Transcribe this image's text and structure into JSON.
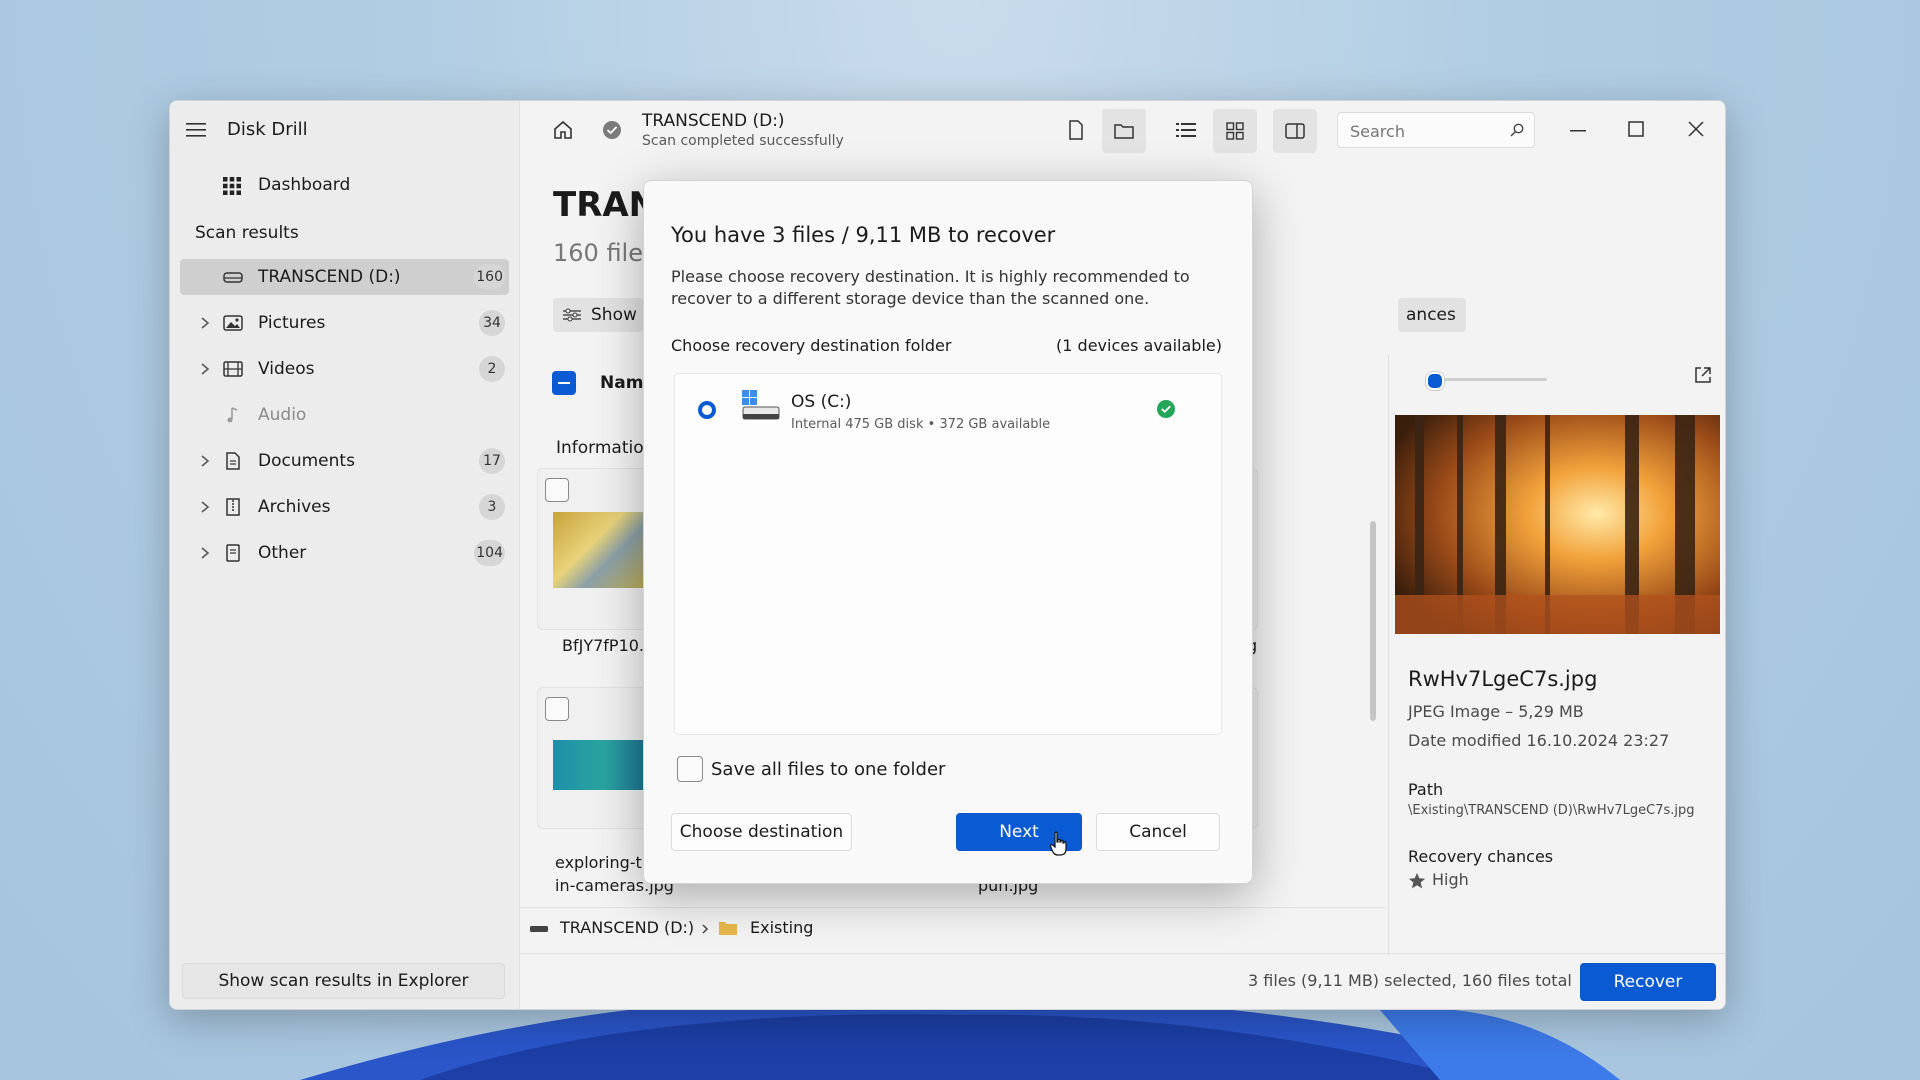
{
  "app": {
    "title": "Disk Drill"
  },
  "sidebar": {
    "dashboard_label": "Dashboard",
    "section_label": "Scan results",
    "items": [
      {
        "label": "TRANSCEND (D:)",
        "count": "160"
      },
      {
        "label": "Pictures",
        "count": "34"
      },
      {
        "label": "Videos",
        "count": "2"
      },
      {
        "label": "Audio",
        "count": ""
      },
      {
        "label": "Documents",
        "count": "17"
      },
      {
        "label": "Archives",
        "count": "3"
      },
      {
        "label": "Other",
        "count": "104"
      }
    ],
    "explorer_button": "Show scan results in Explorer"
  },
  "header": {
    "device": "TRANSCEND (D:)",
    "status": "Scan completed successfully",
    "search_placeholder": "Search"
  },
  "main": {
    "title_partial": "TRAN",
    "subtitle_partial": "160 files",
    "show_button": "Show",
    "chances_partial": "ances",
    "name_column": "Name",
    "info_partial": "Information",
    "files": [
      {
        "name": "BfJY7fP10."
      },
      {
        "name_line1": "exploring-t",
        "name_line2": "in-cameras.jpg"
      },
      {
        "name": "g"
      },
      {
        "name": "pun.jpg"
      }
    ],
    "breadcrumb": {
      "drive": "TRANSCEND (D:)",
      "folder": "Existing"
    }
  },
  "preview": {
    "filename": "RwHv7LgeC7s.jpg",
    "type_size": "JPEG Image – 5,29 MB",
    "date_modified": "Date modified 16.10.2024 23:27",
    "path_label": "Path",
    "path_value": "\\Existing\\TRANSCEND (D)\\RwHv7LgeC7s.jpg",
    "recovery_label": "Recovery chances",
    "recovery_value": "High"
  },
  "footer": {
    "selection_summary": "3 files (9,11 MB) selected, 160 files total",
    "recover_button": "Recover"
  },
  "dialog": {
    "title": "You have 3 files / 9,11 MB to recover",
    "description_line1": "Please choose recovery destination. It is highly recommended to",
    "description_line2": "recover to a different storage device than the scanned one.",
    "section_label": "Choose recovery destination folder",
    "devices_available": "(1 devices available)",
    "device": {
      "name": "OS (C:)",
      "details": "Internal 475 GB disk • 372 GB available"
    },
    "save_one_folder_label": "Save all files to one folder",
    "choose_destination_button": "Choose destination",
    "next_button": "Next",
    "cancel_button": "Cancel"
  },
  "colors": {
    "accent": "#0a5bd3",
    "success": "#23a55a"
  }
}
